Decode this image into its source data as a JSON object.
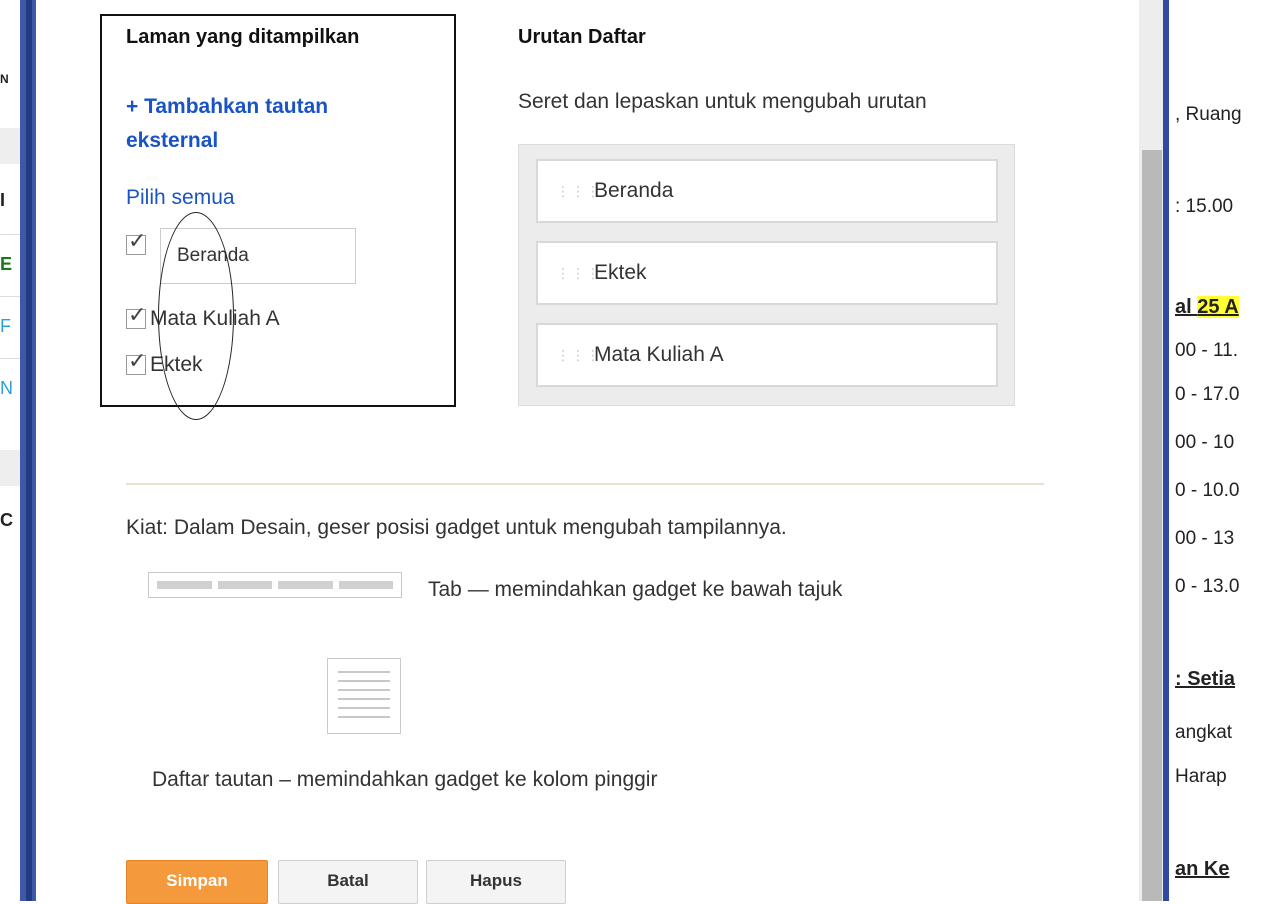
{
  "pages_panel": {
    "title": "Laman yang ditampilkan",
    "add_external_link": "+ Tambahkan tautan eksternal",
    "select_all": "Pilih semua",
    "rename_value": "Beranda",
    "items": [
      {
        "label": "",
        "checked": true
      },
      {
        "label": "Mata Kuliah A",
        "checked": true
      },
      {
        "label": "Ektek",
        "checked": true
      }
    ]
  },
  "order_panel": {
    "title": "Urutan Daftar",
    "hint": "Seret dan lepaskan untuk mengubah urutan",
    "items": [
      "Beranda",
      "Ektek",
      "Mata Kuliah A"
    ]
  },
  "tips": {
    "text": "Kiat: Dalam Desain, geser posisi gadget untuk mengubah tampilannya.",
    "tab_desc": "Tab — memindahkan gadget ke bawah tajuk",
    "list_desc": "Daftar tautan – memindahkan gadget ke kolom pinggir"
  },
  "buttons": {
    "save": "Simpan",
    "cancel": "Batal",
    "delete": "Hapus"
  },
  "left_strip": {
    "letters": [
      "N",
      "I",
      "E",
      "F",
      "N",
      "C"
    ],
    "letter_colors": [
      "#222222",
      "#222222",
      "#1a7a1a",
      "#2aa0d6",
      "#2aa0d6",
      "#222222"
    ]
  },
  "background_page": {
    "lines": [
      ", Ruang",
      ": 15.00",
      "al 25 A",
      "00 - 11.",
      "0 - 17.0",
      "00 - 10",
      "0 - 10.0",
      "00 - 13",
      "0 - 13.0",
      ": Setia",
      "angkat",
      "Harap",
      "an Ke"
    ]
  },
  "colors": {
    "link_blue": "#1a54c4",
    "save_orange": "#f59a3c",
    "border_blue": "#2b4aa0",
    "highlight_yellow": "#ffff33"
  }
}
